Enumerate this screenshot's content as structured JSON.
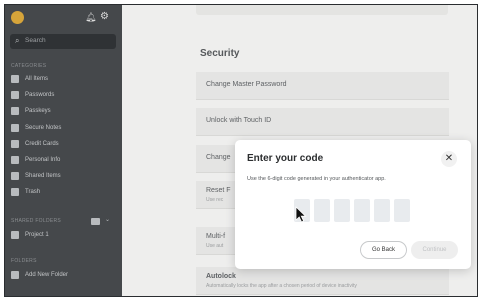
{
  "sidebar": {
    "search_placeholder": "Search",
    "sections": {
      "categories": "Categories",
      "shared_folders": "Shared Folders",
      "folders": "Folders"
    },
    "items": [
      {
        "label": "All Items",
        "icon": "grid-icon"
      },
      {
        "label": "Passwords",
        "icon": "key-icon"
      },
      {
        "label": "Passkeys",
        "icon": "passkey-icon"
      },
      {
        "label": "Secure Notes",
        "icon": "note-icon"
      },
      {
        "label": "Credit Cards",
        "icon": "card-icon"
      },
      {
        "label": "Personal Info",
        "icon": "person-icon"
      },
      {
        "label": "Shared Items",
        "icon": "people-icon"
      },
      {
        "label": "Trash",
        "icon": "trash-icon"
      }
    ],
    "shared_folder_item": "Project 1",
    "add_folder_label": "Add New Folder"
  },
  "main": {
    "section_title": "Security",
    "rows": [
      {
        "title": "Change Master Password",
        "subtitle": ""
      },
      {
        "title": "Unlock with Touch ID",
        "subtitle": ""
      },
      {
        "title": "Change",
        "subtitle": ""
      },
      {
        "title": "Reset F",
        "subtitle": "Use rec"
      },
      {
        "title": "Multi-f",
        "subtitle": "Use aut"
      },
      {
        "title": "Autolock",
        "subtitle": "Automatically locks the app after a chosen period of device inactivity"
      }
    ]
  },
  "modal": {
    "title": "Enter your code",
    "description": "Use the 6-digit code generated in your authenticator app.",
    "digit_count": 6,
    "back_label": "Go Back",
    "continue_label": "Continue"
  },
  "colors": {
    "sidebar_bg": "#45484b",
    "avatar": "#d6a43a",
    "modal_bg": "#ffffff"
  }
}
